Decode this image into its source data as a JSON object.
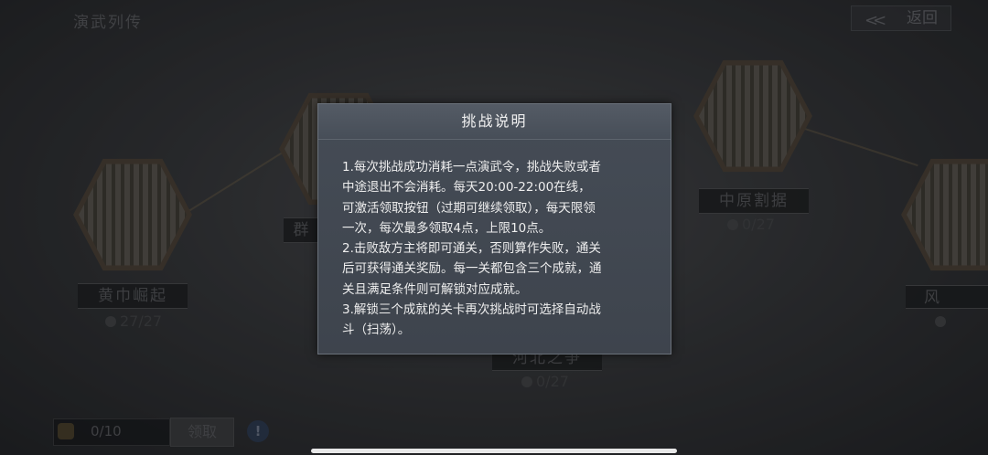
{
  "page": {
    "title": "演武列传",
    "back_label": "返回"
  },
  "nodes": [
    {
      "name": "黄巾崛起",
      "progress": "27/27"
    },
    {
      "name": "群",
      "progress": ""
    },
    {
      "name": "河北之争",
      "progress": "0/27"
    },
    {
      "name": "中原割据",
      "progress": "0/27"
    },
    {
      "name": "风",
      "progress": ""
    }
  ],
  "bottom": {
    "counter": "0/10",
    "claim_label": "领取",
    "info_label": "!"
  },
  "dialog": {
    "title": "挑战说明",
    "lines": [
      "1.每次挑战成功消耗一点演武令，挑战失败或者",
      "中途退出不会消耗。每天20:00-22:00在线，",
      "可激活领取按钮（过期可继续领取），每天限领",
      "一次，每次最多领取4点，上限10点。",
      "2.击败敌方主将即可通关，否则算作失败，通关",
      "后可获得通关奖励。每一关都包含三个成就，通",
      "关且满足条件则可解锁对应成就。",
      "3.解锁三个成就的关卡再次挑战时可选择自动战",
      "斗（扫荡）。"
    ]
  }
}
